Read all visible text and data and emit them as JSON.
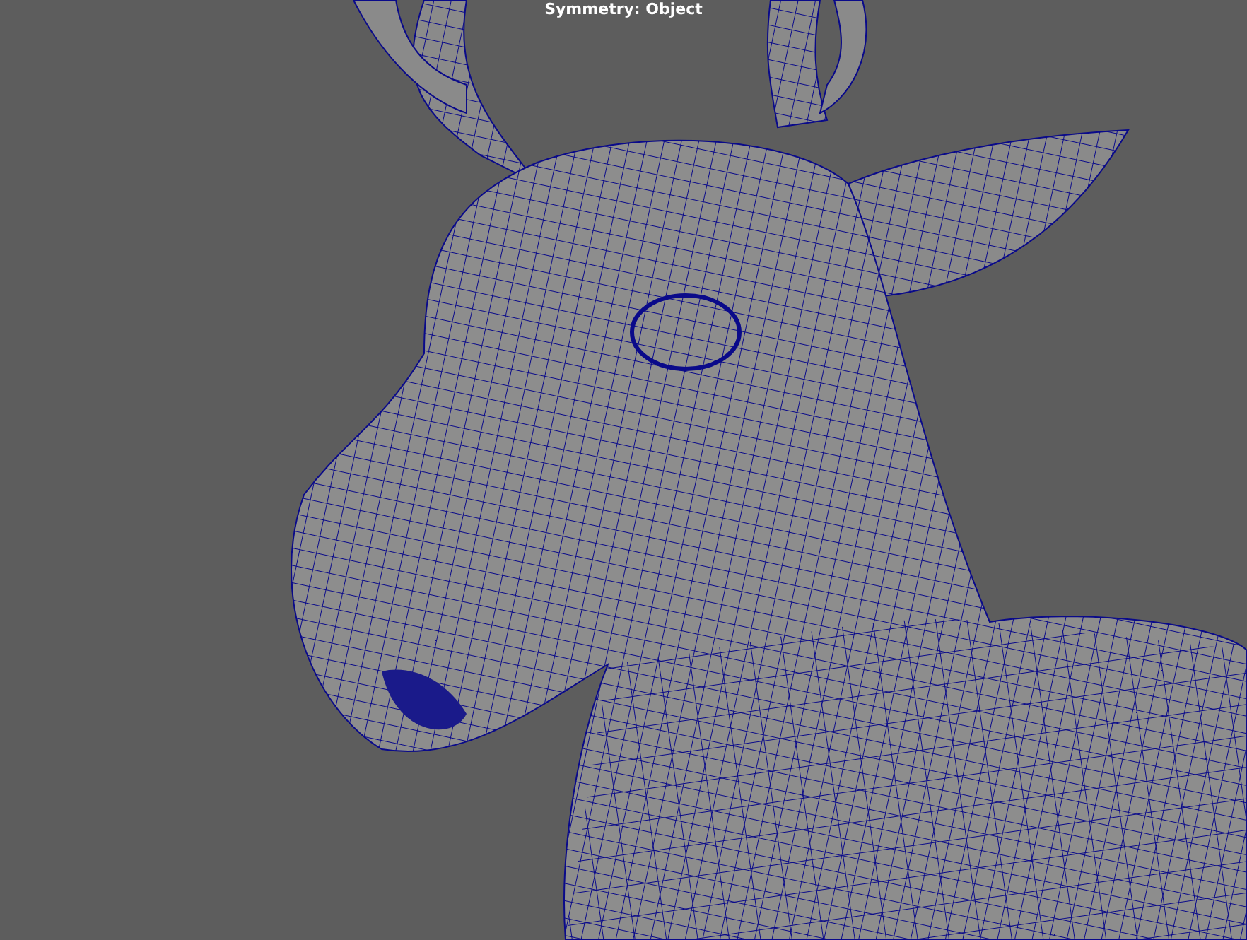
{
  "viewport": {
    "heading": "Symmetry: Object"
  }
}
